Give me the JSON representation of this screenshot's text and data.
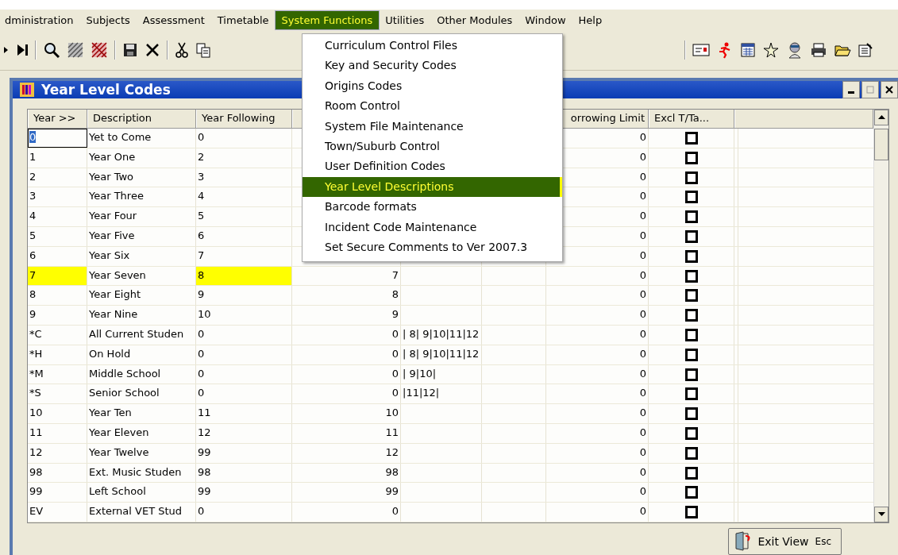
{
  "menu_bar": [
    {
      "label": "dministration",
      "selected": false
    },
    {
      "label": "Subjects",
      "selected": false
    },
    {
      "label": "Assessment",
      "selected": false
    },
    {
      "label": "Timetable",
      "selected": false
    },
    {
      "label": "System Functions",
      "selected": true
    },
    {
      "label": "Utilities",
      "selected": false
    },
    {
      "label": "Other Modules",
      "selected": false
    },
    {
      "label": "Window",
      "selected": false
    },
    {
      "label": "Help",
      "selected": false
    }
  ],
  "dropdown_menu": [
    {
      "label": "Curriculum Control Files",
      "selected": false
    },
    {
      "label": "Key and Security Codes",
      "selected": false
    },
    {
      "label": "Origins Codes",
      "selected": false
    },
    {
      "label": "Room Control",
      "selected": false
    },
    {
      "label": "System File Maintenance",
      "selected": false
    },
    {
      "label": "Town/Suburb Control",
      "selected": false
    },
    {
      "label": "User Definition Codes",
      "selected": false
    },
    {
      "label": "Year Level Descriptions",
      "selected": true
    },
    {
      "label": "Barcode formats",
      "selected": false
    },
    {
      "label": "Incident Code Maintenance",
      "selected": false
    },
    {
      "label": "Set Secure Comments to Ver 2007.3",
      "selected": false
    }
  ],
  "window": {
    "title": "Year Level Codes"
  },
  "table": {
    "columns": [
      "Year >>",
      "Description",
      "Year Following",
      "orrowing Limit",
      "Excl T/Ta..."
    ],
    "rows": [
      {
        "year": "0",
        "description": "Yet to Come",
        "year_following": "0",
        "borrowing_limit": "0",
        "excl": false,
        "highlighted": false,
        "focused": true
      },
      {
        "year": "1",
        "description": "Year One",
        "year_following": "2",
        "borrowing_limit": "0",
        "excl": false,
        "highlighted": false,
        "focused": false
      },
      {
        "year": "2",
        "description": "Year Two",
        "year_following": "3",
        "borrowing_limit": "0",
        "excl": false,
        "highlighted": false,
        "focused": false
      },
      {
        "year": "3",
        "description": "Year Three",
        "year_following": "4",
        "borrowing_limit": "0",
        "excl": false,
        "highlighted": false,
        "focused": false
      },
      {
        "year": "4",
        "description": "Year Four",
        "year_following": "5",
        "borrowing_limit": "0",
        "excl": false,
        "highlighted": false,
        "focused": false
      },
      {
        "year": "5",
        "description": "Year Five",
        "year_following": "6",
        "borrowing_limit": "0",
        "excl": false,
        "highlighted": false,
        "focused": false
      },
      {
        "year": "6",
        "description": "Year Six",
        "year_following": "7",
        "borrowing_limit": "0",
        "excl": false,
        "highlighted": false,
        "focused": false
      },
      {
        "year": "7",
        "description": "Year Seven",
        "year_following": "8",
        "column_4": "7",
        "borrowing_limit": "0",
        "excl": false,
        "highlighted": true,
        "focused": false
      },
      {
        "year": "8",
        "description": "Year Eight",
        "year_following": "9",
        "column_4": "8",
        "borrowing_limit": "0",
        "excl": false,
        "highlighted": false,
        "focused": false
      },
      {
        "year": "9",
        "description": "Year Nine",
        "year_following": "10",
        "column_4": "9",
        "borrowing_limit": "0",
        "excl": false,
        "highlighted": false,
        "focused": false
      },
      {
        "year": "*C",
        "description": "All Current Studen",
        "year_following": "0",
        "column_4": "0",
        "column_5": "| 8| 9|10|11|12",
        "borrowing_limit": "0",
        "excl": false,
        "highlighted": false,
        "focused": false
      },
      {
        "year": "*H",
        "description": "On Hold",
        "year_following": "0",
        "column_4": "0",
        "column_5": "| 8| 9|10|11|12",
        "borrowing_limit": "0",
        "excl": false,
        "highlighted": false,
        "focused": false
      },
      {
        "year": "*M",
        "description": "Middle School",
        "year_following": "0",
        "column_4": "0",
        "column_5": "| 9|10|",
        "borrowing_limit": "0",
        "excl": false,
        "highlighted": false,
        "focused": false
      },
      {
        "year": "*S",
        "description": "Senior School",
        "year_following": "0",
        "column_4": "0",
        "column_5": "|11|12|",
        "borrowing_limit": "0",
        "excl": false,
        "highlighted": false,
        "focused": false
      },
      {
        "year": "10",
        "description": "Year Ten",
        "year_following": "11",
        "column_4": "10",
        "borrowing_limit": "0",
        "excl": false,
        "highlighted": false,
        "focused": false
      },
      {
        "year": "11",
        "description": "Year Eleven",
        "year_following": "12",
        "column_4": "11",
        "borrowing_limit": "0",
        "excl": false,
        "highlighted": false,
        "focused": false
      },
      {
        "year": "12",
        "description": "Year Twelve",
        "year_following": "99",
        "column_4": "12",
        "borrowing_limit": "0",
        "excl": false,
        "highlighted": false,
        "focused": false
      },
      {
        "year": "98",
        "description": "Ext. Music Studen",
        "year_following": "98",
        "column_4": "98",
        "borrowing_limit": "0",
        "excl": false,
        "highlighted": false,
        "focused": false
      },
      {
        "year": "99",
        "description": "Left School",
        "year_following": "99",
        "column_4": "99",
        "borrowing_limit": "0",
        "excl": false,
        "highlighted": false,
        "focused": false
      },
      {
        "year": "EV",
        "description": "External VET Stud",
        "year_following": "0",
        "column_4": "0",
        "borrowing_limit": "0",
        "excl": false,
        "highlighted": false,
        "focused": false
      }
    ]
  },
  "exit_button": {
    "label": "Exit View",
    "shortcut": "Esc"
  }
}
